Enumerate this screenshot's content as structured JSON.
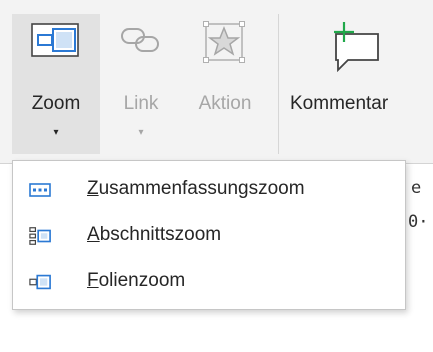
{
  "ribbon": {
    "zoom": {
      "label": "Zoom",
      "chevron": "▾",
      "icon": "zoom-icon"
    },
    "link": {
      "label": "Link",
      "chevron": "▾",
      "icon": "link-icon"
    },
    "aktion": {
      "label": "Aktion",
      "icon": "action-star-icon"
    },
    "kommentar": {
      "label": "Kommentar",
      "icon": "comment-icon"
    }
  },
  "background": {
    "snippet_1": "e",
    "snippet_2": "0·"
  },
  "dropdown": {
    "items": [
      {
        "label": "Zusammenfassungszoom",
        "icon": "summary-zoom-icon"
      },
      {
        "label": "Abschnittszoom",
        "icon": "section-zoom-icon"
      },
      {
        "label": "Folienzoom",
        "icon": "slide-zoom-icon"
      }
    ]
  },
  "colors": {
    "accent_blue": "#2b79d4",
    "comment_green": "#20a84a",
    "disabled_text": "#a6a6a6",
    "pressed_bg": "#e2e2e2"
  }
}
